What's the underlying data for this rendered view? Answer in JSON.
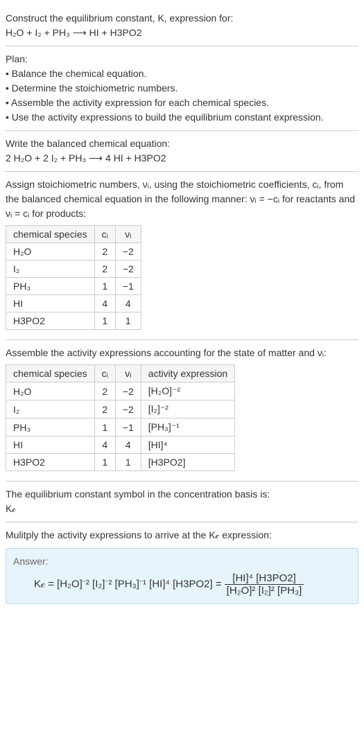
{
  "header": {
    "title_line1": "Construct the equilibrium constant, K, expression for:",
    "equation_unbalanced": "H₂O + I₂ + PH₃  ⟶  HI + H3PO2"
  },
  "plan": {
    "heading": "Plan:",
    "items": [
      "Balance the chemical equation.",
      "Determine the stoichiometric numbers.",
      "Assemble the activity expression for each chemical species.",
      "Use the activity expressions to build the equilibrium constant expression."
    ]
  },
  "balanced": {
    "heading": "Write the balanced chemical equation:",
    "equation": "2 H₂O + 2 I₂ + PH₃  ⟶  4 HI + H3PO2"
  },
  "stoich": {
    "heading": "Assign stoichiometric numbers, νᵢ, using the stoichiometric coefficients, cᵢ, from the balanced chemical equation in the following manner: νᵢ = −cᵢ for reactants and νᵢ = cᵢ for products:",
    "cols": [
      "chemical species",
      "cᵢ",
      "νᵢ"
    ],
    "rows": [
      {
        "species": "H₂O",
        "c": "2",
        "v": "−2"
      },
      {
        "species": "I₂",
        "c": "2",
        "v": "−2"
      },
      {
        "species": "PH₃",
        "c": "1",
        "v": "−1"
      },
      {
        "species": "HI",
        "c": "4",
        "v": "4"
      },
      {
        "species": "H3PO2",
        "c": "1",
        "v": "1"
      }
    ]
  },
  "activity": {
    "heading": "Assemble the activity expressions accounting for the state of matter and νᵢ:",
    "cols": [
      "chemical species",
      "cᵢ",
      "νᵢ",
      "activity expression"
    ],
    "rows": [
      {
        "species": "H₂O",
        "c": "2",
        "v": "−2",
        "expr": "[H₂O]⁻²"
      },
      {
        "species": "I₂",
        "c": "2",
        "v": "−2",
        "expr": "[I₂]⁻²"
      },
      {
        "species": "PH₃",
        "c": "1",
        "v": "−1",
        "expr": "[PH₃]⁻¹"
      },
      {
        "species": "HI",
        "c": "4",
        "v": "4",
        "expr": "[HI]⁴"
      },
      {
        "species": "H3PO2",
        "c": "1",
        "v": "1",
        "expr": "[H3PO2]"
      }
    ]
  },
  "kc_symbol": {
    "heading": "The equilibrium constant symbol in the concentration basis is:",
    "symbol": "K𝒸"
  },
  "multiply": {
    "heading": "Mulitply the activity expressions to arrive at the K𝒸 expression:"
  },
  "answer": {
    "label": "Answer:",
    "lhs": "K𝒸 = [H₂O]⁻² [I₂]⁻² [PH₃]⁻¹ [HI]⁴ [H3PO2] = ",
    "frac_top": "[HI]⁴ [H3PO2]",
    "frac_bot": "[H₂O]² [I₂]² [PH₃]"
  },
  "chart_data": {
    "type": "table",
    "tables": [
      {
        "name": "stoichiometric_numbers",
        "columns": [
          "chemical species",
          "c_i",
          "nu_i"
        ],
        "rows": [
          [
            "H2O",
            2,
            -2
          ],
          [
            "I2",
            2,
            -2
          ],
          [
            "PH3",
            1,
            -1
          ],
          [
            "HI",
            4,
            4
          ],
          [
            "H3PO2",
            1,
            1
          ]
        ]
      },
      {
        "name": "activity_expressions",
        "columns": [
          "chemical species",
          "c_i",
          "nu_i",
          "activity expression"
        ],
        "rows": [
          [
            "H2O",
            2,
            -2,
            "[H2O]^-2"
          ],
          [
            "I2",
            2,
            -2,
            "[I2]^-2"
          ],
          [
            "PH3",
            1,
            -1,
            "[PH3]^-1"
          ],
          [
            "HI",
            4,
            4,
            "[HI]^4"
          ],
          [
            "H3PO2",
            1,
            1,
            "[H3PO2]"
          ]
        ]
      }
    ]
  }
}
